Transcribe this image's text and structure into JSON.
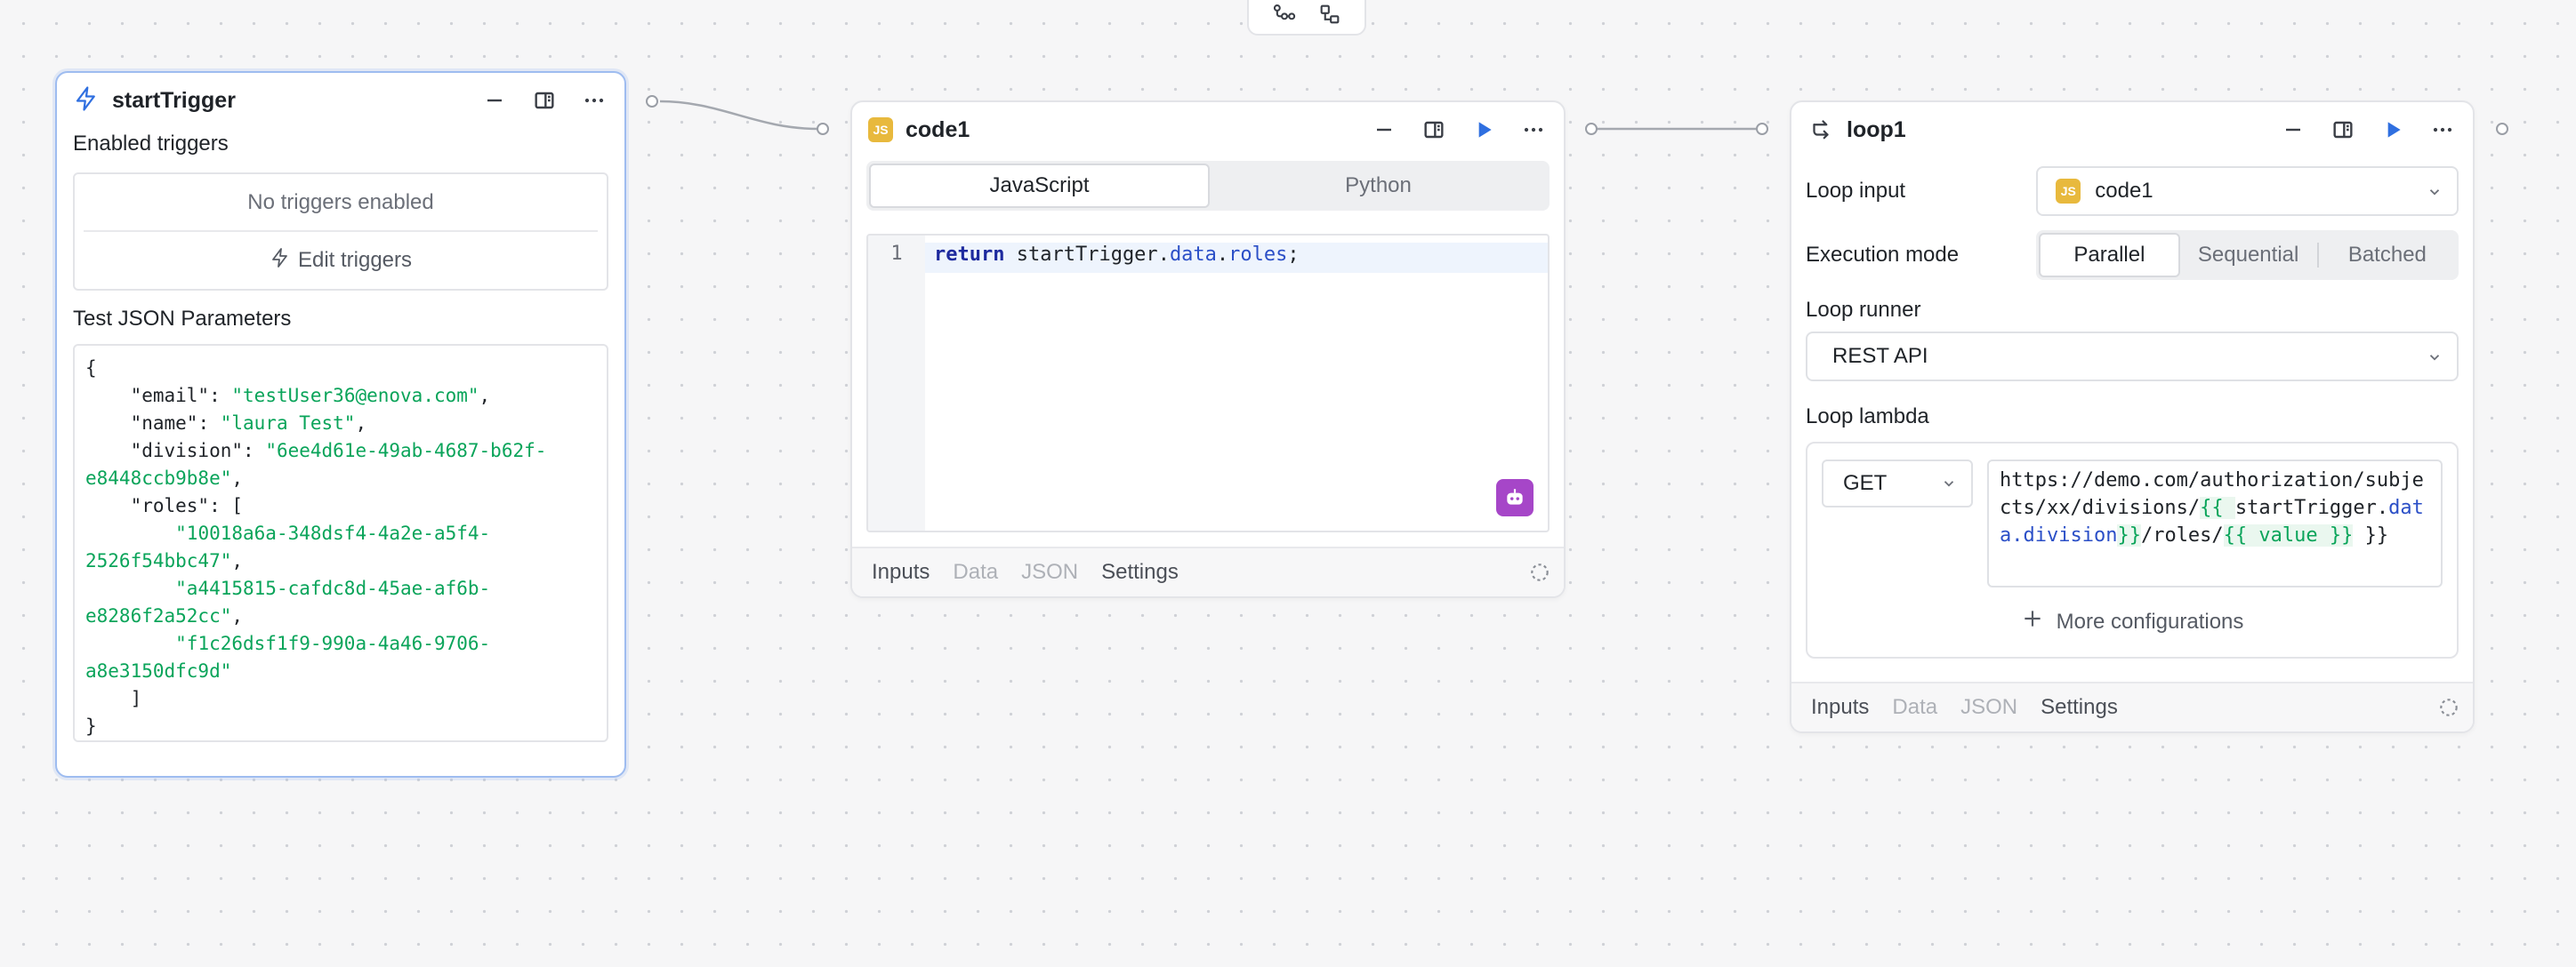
{
  "colors": {
    "accent_blue": "#2f6fe0",
    "template_green": "#0aa45a",
    "ai_purple": "#a646c8",
    "js_badge": "#e8b93d"
  },
  "toolbar": {
    "icons": [
      "flow-tree-icon",
      "layout-icon"
    ]
  },
  "start_trigger": {
    "title": "startTrigger",
    "enabled_triggers_label": "Enabled triggers",
    "no_triggers_text": "No triggers enabled",
    "edit_triggers_label": "Edit triggers",
    "test_json_label": "Test JSON Parameters",
    "json": {
      "open": "{",
      "email_key": "\"email\"",
      "email_val": "\"testUser36@enova.com\"",
      "name_key": "\"name\"",
      "name_val": "\"laura Test\"",
      "division_key": "\"division\"",
      "division_val_1": "\"6ee4d61e-49ab-4687-b62f-",
      "division_val_2": "e8448ccb9b8e\"",
      "roles_key": "\"roles\"",
      "role1_a": "\"10018a6a-348dsf4-4a2e-a5f4-",
      "role1_b": "2526f54bbc47\"",
      "role2_a": "\"a4415815-cafdc8d-45ae-af6b-",
      "role2_b": "e8286f2a52cc\"",
      "role3_a": "\"f1c26dsf1f9-990a-4a46-9706-",
      "role3_b": "a8e3150dfc9d\"",
      "roles_close": "]",
      "close": "}"
    }
  },
  "code1": {
    "title": "code1",
    "badge": "JS",
    "tabs": [
      "JavaScript",
      "Python"
    ],
    "active_tab": "JavaScript",
    "line_number": "1",
    "code": {
      "keyword": "return",
      "obj": "startTrigger",
      "p1": "data",
      "p2": "roles",
      "end": ";"
    },
    "footer_tabs": [
      "Inputs",
      "Data",
      "JSON",
      "Settings"
    ]
  },
  "loop1": {
    "title": "loop1",
    "loop_input_label": "Loop input",
    "loop_input_value": "code1",
    "loop_input_badge": "JS",
    "execution_mode_label": "Execution mode",
    "execution_modes": [
      "Parallel",
      "Sequential",
      "Batched"
    ],
    "active_mode": "Parallel",
    "loop_runner_label": "Loop runner",
    "loop_runner_value": "REST API",
    "loop_lambda_label": "Loop lambda",
    "method": "GET",
    "url": {
      "p1": "https://demo.com/authorization/subjects/xx/divisions/",
      "t1_open": "{{ ",
      "t1_obj": "startTrigger",
      "t1_path": "data.division",
      "t1_close": "}}",
      "p2": "/roles/",
      "t2": "{{ value }}",
      "p3": " }}"
    },
    "more_configurations_label": "More configurations",
    "footer_tabs": [
      "Inputs",
      "Data",
      "JSON",
      "Settings"
    ]
  }
}
